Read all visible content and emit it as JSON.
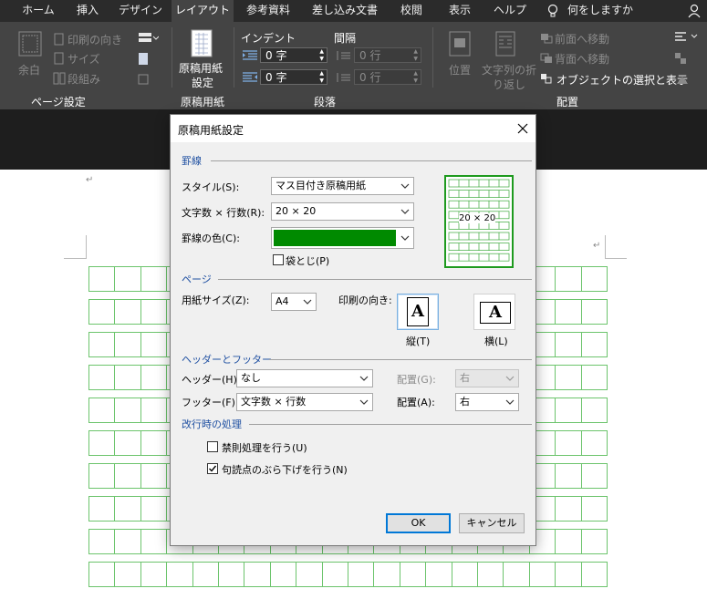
{
  "ribbon": {
    "tabs": [
      "ホーム",
      "挿入",
      "デザイン",
      "レイアウト",
      "参考資料",
      "差し込み文書",
      "校閲",
      "表示",
      "ヘルプ"
    ],
    "active_tab": "レイアウト",
    "tell_me": "何をしますか",
    "page_setup": {
      "margins": "余白",
      "orientation": "印刷の向き",
      "size": "サイズ",
      "columns": "段組み",
      "group_label": "ページ設定"
    },
    "genko": {
      "button_line1": "原稿用紙",
      "button_line2": "設定",
      "group_label": "原稿用紙"
    },
    "paragraph": {
      "indent_label": "インデント",
      "spacing_label": "間隔",
      "indent_left": "0 字",
      "indent_right": "0 字",
      "spacing_before": "0 行",
      "spacing_after": "0 行",
      "group_label": "段落"
    },
    "arrange": {
      "position": "位置",
      "wrap_line1": "文字列の折",
      "wrap_line2": "り返し",
      "bring_forward": "前面へ移動",
      "send_backward": "背面へ移動",
      "selection_pane": "オブジェクトの選択と表示",
      "group_label": "配置"
    }
  },
  "dialog": {
    "title": "原稿用紙設定",
    "close_icon": "close-icon",
    "grid": {
      "section": "罫線",
      "style_label": "スタイル(S):",
      "style_value": "マス目付き原稿用紙",
      "chars_label": "文字数 × 行数(R):",
      "chars_value": "20 × 20",
      "color_label": "罫線の色(C):",
      "color_value": "#008a00",
      "fukuro_label": "袋とじ(P)",
      "fukuro_checked": false,
      "preview_label": "20 × 20"
    },
    "page": {
      "section": "ページ",
      "size_label": "用紙サイズ(Z):",
      "size_value": "A4",
      "orient_label": "印刷の向き:",
      "portrait_label": "縦(T)",
      "landscape_label": "横(L)",
      "orient_glyph": "A"
    },
    "header_footer": {
      "section": "ヘッダーとフッター",
      "header_label": "ヘッダー(H):",
      "header_value": "なし",
      "header_pos_label": "配置(G):",
      "header_pos_value": "右",
      "footer_label": "フッター(F):",
      "footer_value": "文字数 × 行数",
      "footer_pos_label": "配置(A):",
      "footer_pos_value": "右"
    },
    "line_break": {
      "section": "改行時の処理",
      "kinsoku_label": "禁則処理を行う(U)",
      "kinsoku_checked": false,
      "burasage_label": "句読点のぶら下げを行う(N)",
      "burasage_checked": true
    },
    "ok_label": "OK",
    "cancel_label": "キャンセル"
  },
  "document": {
    "paragraph_mark": "↵"
  }
}
